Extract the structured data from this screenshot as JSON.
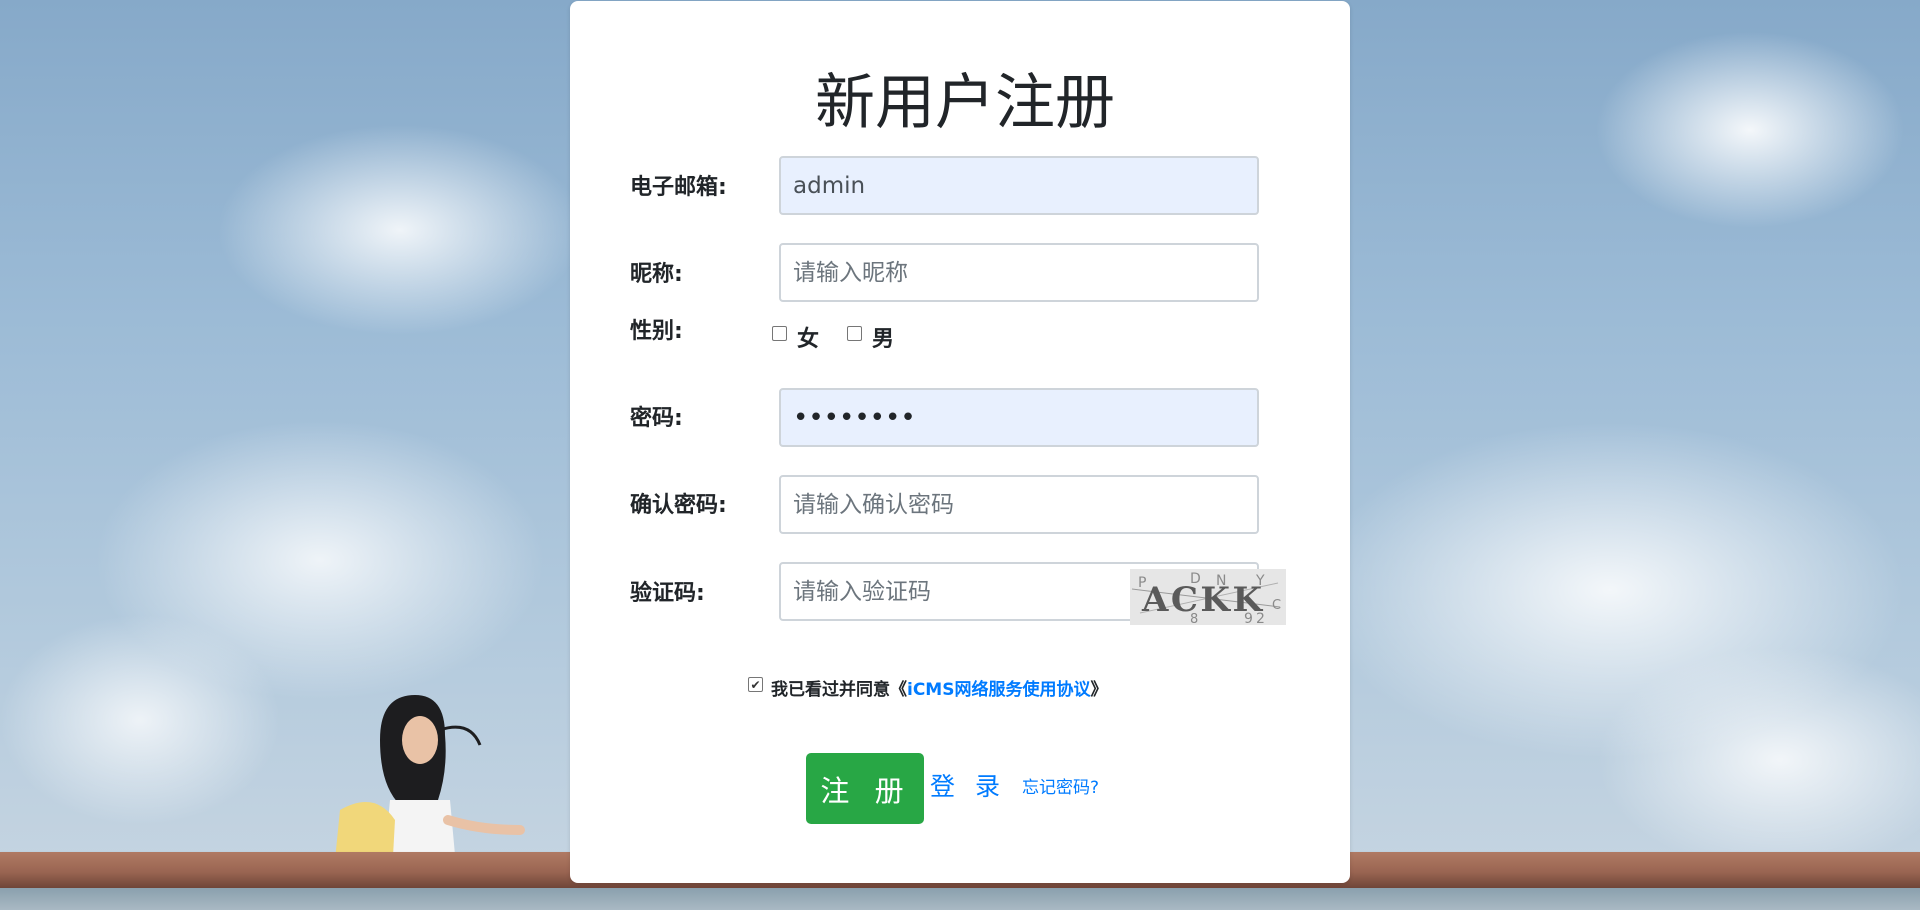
{
  "form": {
    "title": "新用户注册",
    "email": {
      "label": "电子邮箱:",
      "value": "admin"
    },
    "nickname": {
      "label": "昵称:",
      "placeholder": "请输入昵称"
    },
    "gender": {
      "label": "性别:",
      "options": [
        "女",
        "男"
      ]
    },
    "password": {
      "label": "密码:",
      "value": "••••••••"
    },
    "confirm_password": {
      "label": "确认密码:",
      "placeholder": "请输入确认密码"
    },
    "captcha": {
      "label": "验证码:",
      "placeholder": "请输入验证码",
      "image_text": "ACKK",
      "noise_chars": [
        "P",
        "D",
        "N",
        "Y",
        "8",
        "9",
        "2",
        "C"
      ]
    },
    "agreement": {
      "prefix": "我已看过并同意《 ",
      "link": "iCMS网络服务使用协议",
      "suffix": "》"
    },
    "register_button": "注 册",
    "login_link": "登 录",
    "forgot_link": "忘记密码?"
  },
  "colors": {
    "primary": "#007bff",
    "success": "#28a745",
    "autofill_bg": "#e8f0fe"
  }
}
